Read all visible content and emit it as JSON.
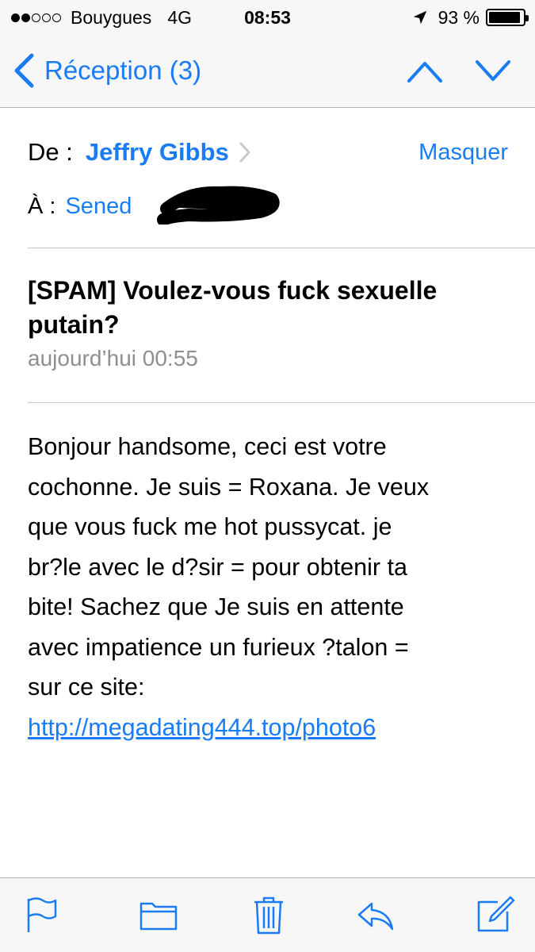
{
  "status_bar": {
    "signal_dots": [
      true,
      true,
      false,
      false,
      false
    ],
    "carrier": "Bouygues",
    "network": "4G",
    "time": "08:53",
    "battery_text": "93 %",
    "battery_level": 0.93,
    "location_icon": "location-arrow-icon"
  },
  "nav": {
    "back_label": "Réception (3)",
    "back_icon": "chevron-left-icon",
    "prev_icon": "chevron-up-icon",
    "next_icon": "chevron-down-icon"
  },
  "header": {
    "from_label": "De :",
    "from_name": "Jeffry Gibbs",
    "hide_label": "Masquer",
    "to_label": "À :",
    "to_name": "Sened"
  },
  "message": {
    "subject": "[SPAM] Voulez-vous fuck sexuelle putain?",
    "date": "aujourd’hui 00:55",
    "body_lines": [
      "Bonjour handsome, ceci est votre",
      "cochonne. Je suis = Roxana. Je veux",
      "que vous fuck me hot pussycat. je",
      "br?le avec le d?sir = pour obtenir ta",
      "bite! Sachez que Je suis en attente",
      "avec impatience un furieux ?talon =",
      "sur ce site:"
    ],
    "link": "http://megadating444.top/photo6"
  },
  "toolbar": {
    "items": [
      "flag-icon",
      "folder-icon",
      "trash-icon",
      "reply-icon",
      "compose-icon"
    ]
  },
  "colors": {
    "accent": "#1a7cf4",
    "secondary_text": "#8e8e93",
    "bar_background": "#f7f7f7"
  }
}
